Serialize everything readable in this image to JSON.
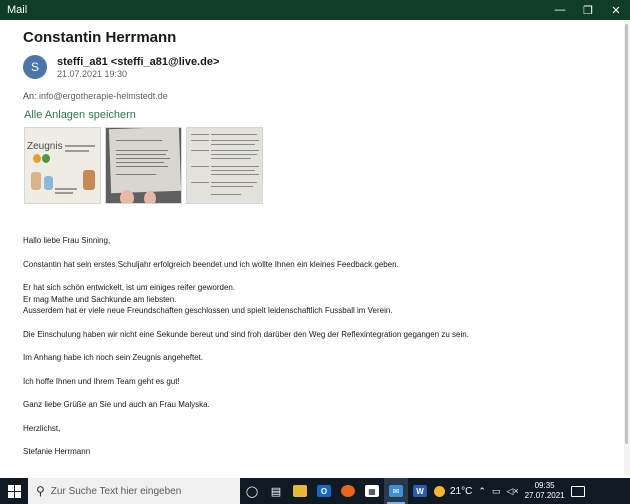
{
  "window": {
    "app_title": "Mail",
    "minimize_icon": "minimize-icon",
    "maximize_icon": "maximize-icon",
    "close_icon": "close-icon"
  },
  "message": {
    "subject": "Constantin Herrmann",
    "avatar_initial": "S",
    "avatar_color": "#4a76a8",
    "sender": "steffi_a81 <steffi_a81@live.de>",
    "date": "21.07.2021 19:30",
    "to_label": "An:",
    "to_address": "info@ergotherapie-helmstedt.de",
    "save_attachments_label": "Alle Anlagen speichern",
    "attachment_thumbnail_text": "Zeugnis",
    "body": {
      "greeting": "Hallo liebe Frau Sinning,",
      "p1": "Constantin hat sein erstes Schuljahr erfolgreich beendet und ich wollte Ihnen ein kleines Feedback geben.",
      "p2_line1": "Er hat sich schön entwickelt, ist um einiges reifer geworden.",
      "p2_line2": "Er mag Mathe und Sachkunde am liebsten.",
      "p2_line3": "Ausserdem hat er viele neue Freundschaften geschlossen und spielt leidenschaftlich Fussball im Verein.",
      "p3": "Die Einschulung haben wir nicht eine Sekunde bereut und sind froh darüber den Weg der Reflexintegration gegangen zu sein.",
      "p4": "Im Anhang habe ich noch sein Zeugnis angeheftet.",
      "p5": "Ich hoffe Ihnen und Ihrem Team geht es gut!",
      "p6": "Ganz liebe Grüße an Sie und auch an Frau Malyska.",
      "closing": "Herzlichst,",
      "signature": "Stefanie Herrmann"
    }
  },
  "taskbar": {
    "search_placeholder": "Zur Suche Text hier eingeben",
    "weather_temp": "21°C",
    "time": "09:35",
    "date": "27.07.2021",
    "accent_color": "#7fb2e6"
  },
  "colors": {
    "title_bar": "#0f3d26",
    "link_green": "#2a7a44",
    "taskbar": "#0f1a24"
  }
}
